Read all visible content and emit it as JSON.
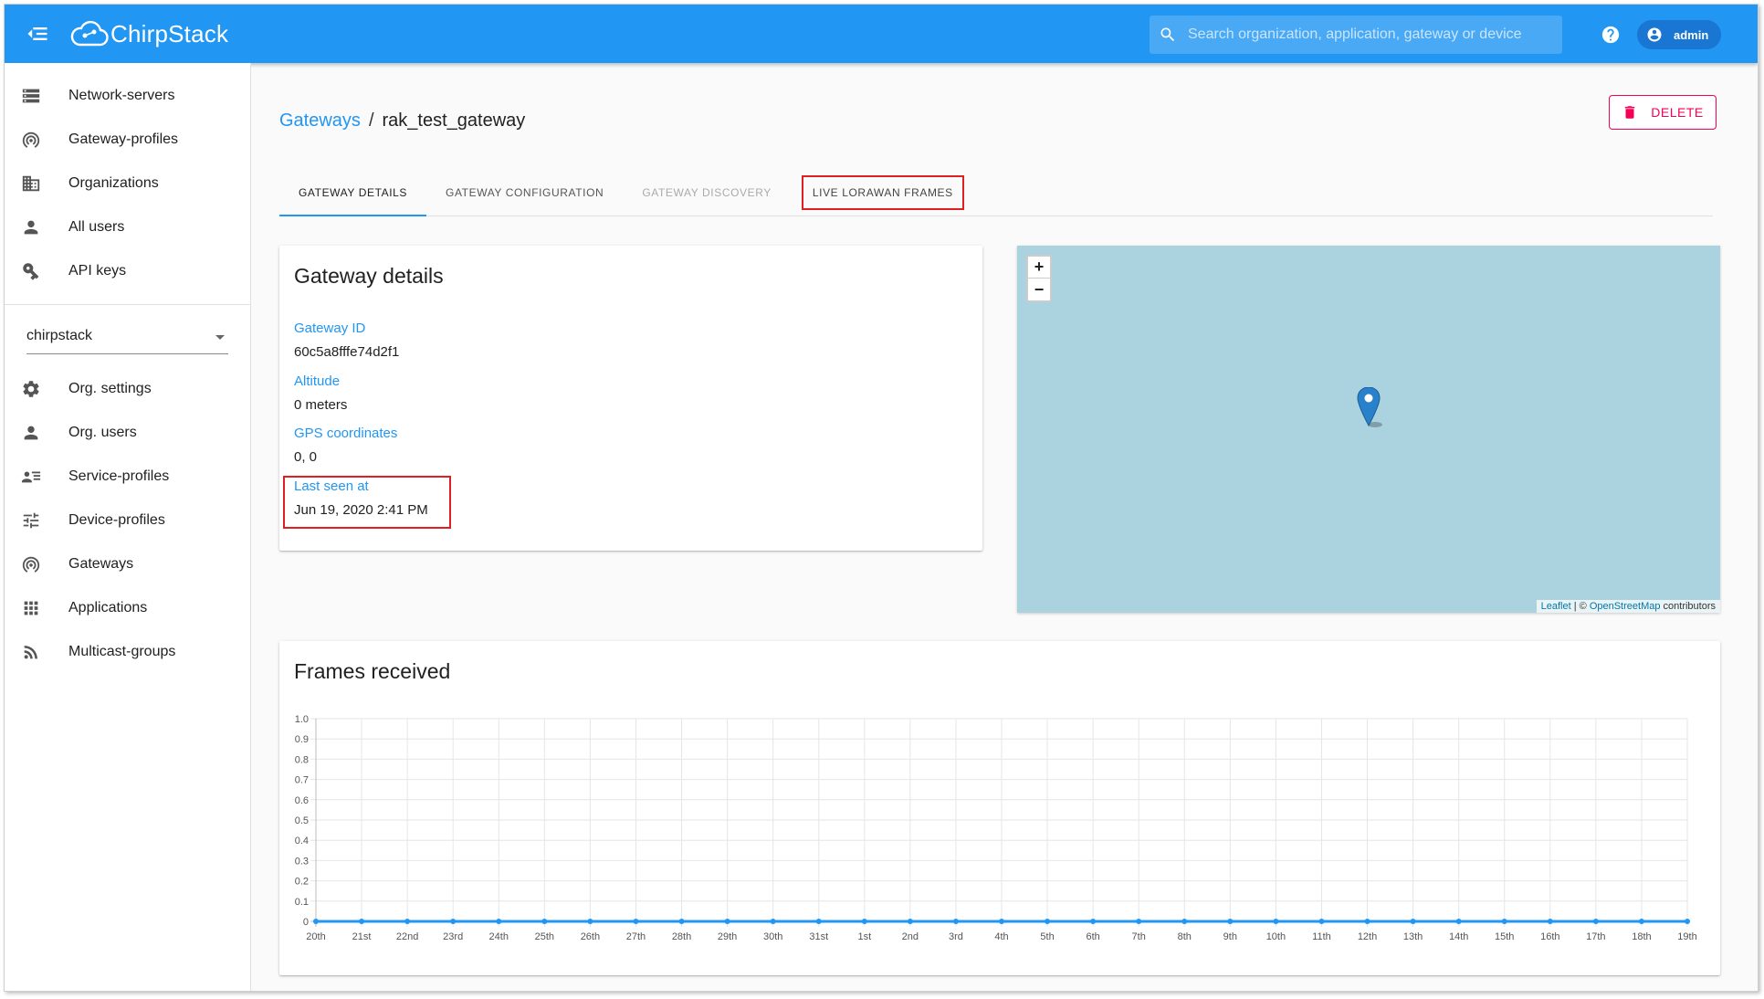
{
  "topbar": {
    "brand": "ChirpStack",
    "search_placeholder": "Search organization, application, gateway or device",
    "user": "admin",
    "icons": [
      "menu-open-icon",
      "cloud-logo-icon",
      "search-icon",
      "help-icon",
      "account-circle-icon"
    ],
    "color": "#2196f3"
  },
  "sidebar": {
    "global_items": [
      {
        "label": "Network-servers",
        "icon": "server-icon"
      },
      {
        "label": "Gateway-profiles",
        "icon": "gateway-icon"
      },
      {
        "label": "Organizations",
        "icon": "domain-icon"
      },
      {
        "label": "All users",
        "icon": "person-icon"
      },
      {
        "label": "API keys",
        "icon": "key-icon"
      }
    ],
    "org_select": "chirpstack",
    "org_items": [
      {
        "label": "Org. settings",
        "icon": "gear-icon"
      },
      {
        "label": "Org. users",
        "icon": "person-icon"
      },
      {
        "label": "Service-profiles",
        "icon": "service-profile-icon"
      },
      {
        "label": "Device-profiles",
        "icon": "tune-icon"
      },
      {
        "label": "Gateways",
        "icon": "gateway-icon"
      },
      {
        "label": "Applications",
        "icon": "apps-icon"
      },
      {
        "label": "Multicast-groups",
        "icon": "rss-icon"
      }
    ]
  },
  "page": {
    "breadcrumb_link": "Gateways",
    "breadcrumb_sep": "/",
    "breadcrumb_current": "rak_test_gateway",
    "delete_label": "DELETE",
    "tabs": [
      {
        "label": "GATEWAY DETAILS",
        "state": "active"
      },
      {
        "label": "GATEWAY CONFIGURATION",
        "state": "normal"
      },
      {
        "label": "GATEWAY DISCOVERY",
        "state": "disabled"
      },
      {
        "label": "LIVE LORAWAN FRAMES",
        "state": "highlighted"
      }
    ]
  },
  "details": {
    "title": "Gateway details",
    "gateway_id_label": "Gateway ID",
    "gateway_id": "60c5a8fffe74d2f1",
    "altitude_label": "Altitude",
    "altitude": "0 meters",
    "gps_label": "GPS coordinates",
    "gps": "0, 0",
    "last_seen_label": "Last seen at",
    "last_seen": "Jun 19, 2020 2:41 PM"
  },
  "map": {
    "zoom_in": "+",
    "zoom_out": "−",
    "attr_leaflet": "Leaflet",
    "attr_sep": " | © ",
    "attr_osm": "OpenStreetMap",
    "attr_tail": " contributors"
  },
  "frames": {
    "title": "Frames received"
  },
  "chart_data": {
    "type": "line",
    "title": "Frames received",
    "categories": [
      "20th",
      "21st",
      "22nd",
      "23rd",
      "24th",
      "25th",
      "26th",
      "27th",
      "28th",
      "29th",
      "30th",
      "31st",
      "1st",
      "2nd",
      "3rd",
      "4th",
      "5th",
      "6th",
      "7th",
      "8th",
      "9th",
      "10th",
      "11th",
      "12th",
      "13th",
      "14th",
      "15th",
      "16th",
      "17th",
      "18th",
      "19th"
    ],
    "series": [
      {
        "values": [
          0,
          0,
          0,
          0,
          0,
          0,
          0,
          0,
          0,
          0,
          0,
          0,
          0,
          0,
          0,
          0,
          0,
          0,
          0,
          0,
          0,
          0,
          0,
          0,
          0,
          0,
          0,
          0,
          0,
          0,
          0
        ],
        "color": "#2196f3"
      }
    ],
    "yticks": [
      "0",
      "0.1",
      "0.2",
      "0.3",
      "0.4",
      "0.5",
      "0.6",
      "0.7",
      "0.8",
      "0.9",
      "1.0"
    ],
    "ylim": [
      0,
      1
    ],
    "grid": true
  }
}
